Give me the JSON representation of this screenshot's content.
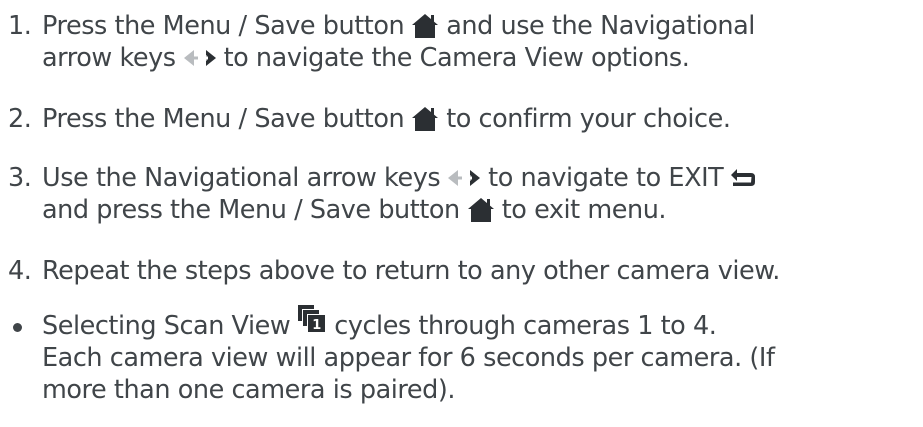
{
  "steps": [
    {
      "number": "1.",
      "line1_before_icon": "Press the Menu / Save button",
      "line1_after_icon": "and use the Navigational",
      "line2_before_icon": "arrow keys",
      "line2_after_icon": "to navigate the Camera View options."
    },
    {
      "number": "2.",
      "line1_before_icon": "Press the Menu / Save button",
      "line1_after_icon": "to confirm your choice."
    },
    {
      "number": "3.",
      "line1_before_icon": "Use the Navigational arrow keys",
      "line1_middle": "to navigate to EXIT",
      "line2_before_icon": "and press the Menu / Save button",
      "line2_after_icon": "to exit menu."
    },
    {
      "number": "4.",
      "line1": "Repeat the steps above to return to any other camera view."
    }
  ],
  "note": {
    "line1_before_icon": "Selecting Scan View",
    "line1_after_icon": "cycles through cameras 1 to 4.",
    "line2": "Each camera view will appear for 6 seconds per camera. (If",
    "line3": "more than one camera is paired).",
    "scan_icon_digit": "1"
  },
  "icons": {
    "menu_save": "home-icon",
    "nav_arrows": "left-right-arrow-keys-icon",
    "exit": "exit-return-icon",
    "scan_view": "scan-view-stack-icon"
  },
  "colors": {
    "text": "#404549",
    "icon": "#2b2f33"
  }
}
